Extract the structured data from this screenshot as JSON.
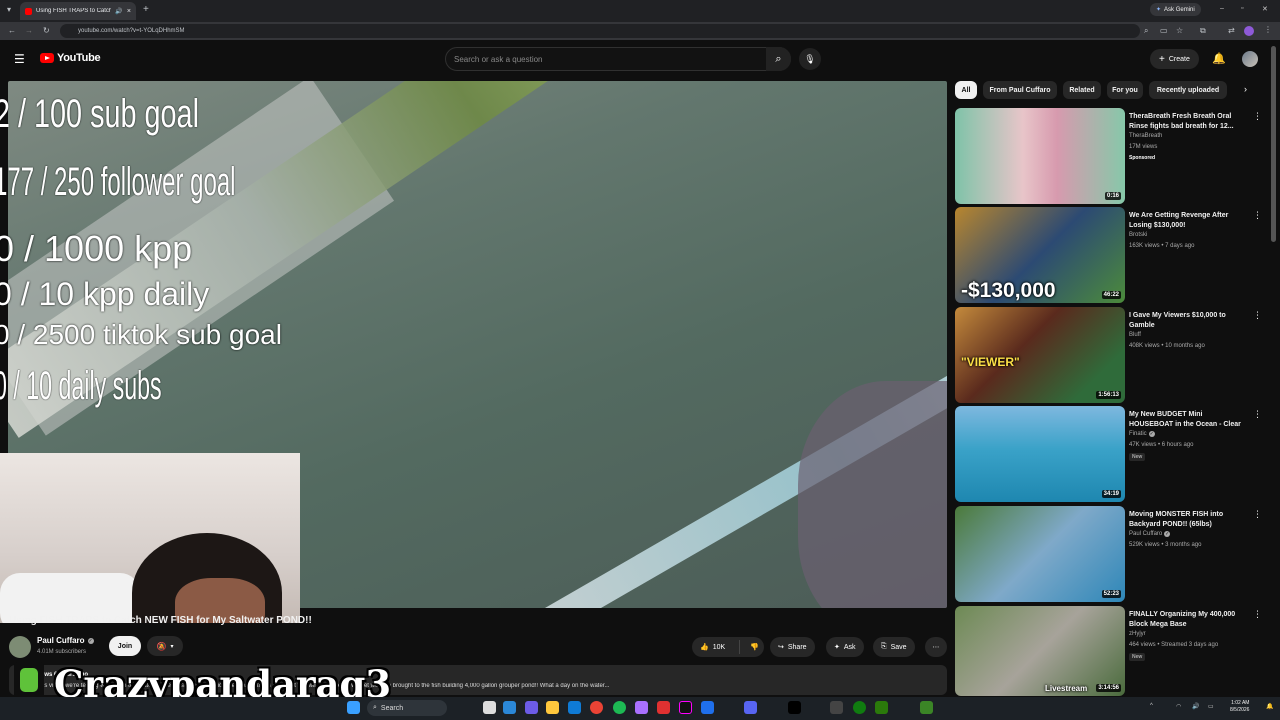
{
  "browser": {
    "tab_title": "Using FISH TRAPS to Catch",
    "url": "youtube.com/watch?v=t-YOLqDHhmSM",
    "gemini_label": "Ask Gemini"
  },
  "youtube": {
    "logo_text": "YouTube",
    "search_placeholder": "Search or ask a question",
    "create_label": "Create"
  },
  "stream_overlay": {
    "goals": [
      "2  / 100 sub goal",
      "177 / 250 follower goal",
      "0 / 1000 kpp",
      "0 / 10 kpp daily",
      "0 / 2500 tiktok sub goal",
      "0 / 10 daily subs"
    ],
    "streamer_name": "Crazypandarag3",
    "rumble_label": "rumble"
  },
  "video": {
    "title": "Using FISH TRAPS to Catch NEW FISH for My Saltwater POND!!",
    "channel_name": "Paul Cuffaro",
    "subscribers": "4.01M subscribers",
    "join_label": "Join",
    "like_count": "10K",
    "share_label": "Share",
    "ask_label": "Ask",
    "save_label": "Save",
    "desc_meta": "views  6 hours ago",
    "description": "This video we're testing which fish trap catches the most fish and whichever trap catches the most fish wins! Whatever we get we also brought to the fish building 4,000 gallon grouper pond!! What a day on the water..."
  },
  "filter_chips": [
    "All",
    "From Paul Cuffaro",
    "Related",
    "For you",
    "Recently uploaded"
  ],
  "recommendations": [
    {
      "title": "TheraBreath Fresh Breath Oral Rinse fights bad breath for 12...",
      "channel": "TheraBreath",
      "meta": "17M views",
      "badge": "Sponsored",
      "duration": "0:16",
      "verified": false
    },
    {
      "title": "We Are Getting Revenge After Losing $130,000!",
      "channel": "Brotski",
      "meta": "163K views • 7 days ago",
      "badge": "",
      "duration": "46:22",
      "verified": false,
      "overlay": "-$130,000"
    },
    {
      "title": "I Gave My Viewers $10,000 to Gamble",
      "channel": "Bluff",
      "meta": "408K views • 10 months ago",
      "badge": "",
      "duration": "1:56:13",
      "verified": false,
      "overlay": "\"VIEWER\""
    },
    {
      "title": "My New BUDGET Mini HOUSEBOAT in the Ocean - Clear ...",
      "channel": "Finatic",
      "meta": "47K views • 6 hours ago",
      "badge": "New",
      "duration": "34:19",
      "verified": true
    },
    {
      "title": "Moving MONSTER FISH into Backyard POND!! (65lbs)",
      "channel": "Paul Cuffaro",
      "meta": "529K views • 3 months ago",
      "badge": "",
      "duration": "52:23",
      "verified": true
    },
    {
      "title": "FINALLY Organizing My 400,000 Block Mega Base",
      "channel": "zHyjyr",
      "meta": "464 views • Streamed 3 days ago",
      "badge": "New",
      "duration": "3:14:56",
      "verified": false,
      "overlay": "Livestream"
    }
  ],
  "taskbar": {
    "search_label": "Search",
    "time": "1:02 AM",
    "date": "8/5/2026"
  },
  "colors": {
    "background": "#0f0f0f",
    "youtube_red": "#ff0000",
    "chip_bg": "#272727",
    "secondary_text": "#aaaaaa"
  }
}
